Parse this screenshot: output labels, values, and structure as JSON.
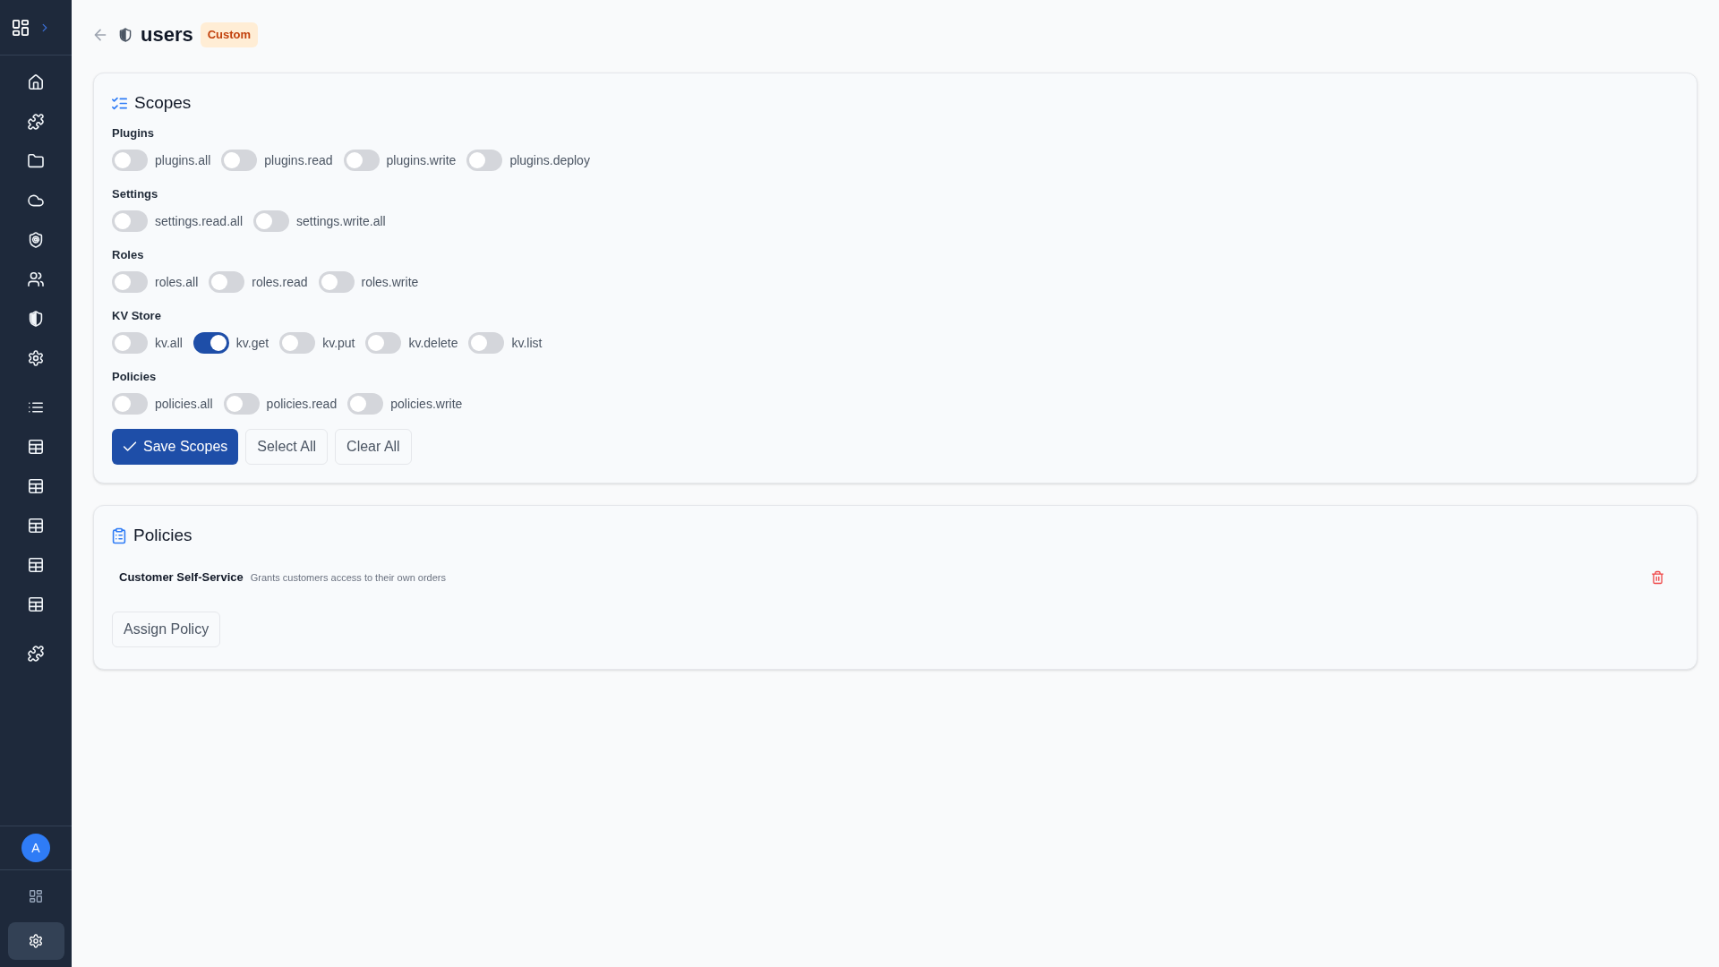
{
  "sidebar": {
    "avatar": "A",
    "footer_buttons": [
      {
        "kind": "grid",
        "selected": false
      },
      {
        "kind": "settings",
        "selected": true
      }
    ]
  },
  "header": {
    "title": "users",
    "badge": "Custom"
  },
  "scopes": {
    "title": "Scopes",
    "groups": [
      {
        "label": "Plugins",
        "scopes": [
          {
            "label": "plugins.all",
            "on": false
          },
          {
            "label": "plugins.read",
            "on": false
          },
          {
            "label": "plugins.write",
            "on": false
          },
          {
            "label": "plugins.deploy",
            "on": false
          }
        ]
      },
      {
        "label": "Settings",
        "scopes": [
          {
            "label": "settings.read.all",
            "on": false
          },
          {
            "label": "settings.write.all",
            "on": false
          }
        ]
      },
      {
        "label": "Roles",
        "scopes": [
          {
            "label": "roles.all",
            "on": false
          },
          {
            "label": "roles.read",
            "on": false
          },
          {
            "label": "roles.write",
            "on": false
          }
        ]
      },
      {
        "label": "KV Store",
        "scopes": [
          {
            "label": "kv.all",
            "on": false
          },
          {
            "label": "kv.get",
            "on": true
          },
          {
            "label": "kv.put",
            "on": false
          },
          {
            "label": "kv.delete",
            "on": false
          },
          {
            "label": "kv.list",
            "on": false
          }
        ]
      },
      {
        "label": "Policies",
        "scopes": [
          {
            "label": "policies.all",
            "on": false
          },
          {
            "label": "policies.read",
            "on": false
          },
          {
            "label": "policies.write",
            "on": false
          }
        ]
      }
    ],
    "buttons": [
      {
        "kind": "save",
        "label": "Save Scopes"
      },
      {
        "kind": "select",
        "label": "Select All"
      },
      {
        "kind": "clear",
        "label": "Clear All"
      }
    ]
  },
  "policies": {
    "title": "Policies",
    "items": [
      {
        "name": "Customer Self-Service",
        "description": "Grants customers access to their own orders"
      }
    ],
    "assign_button": "Assign Policy"
  }
}
